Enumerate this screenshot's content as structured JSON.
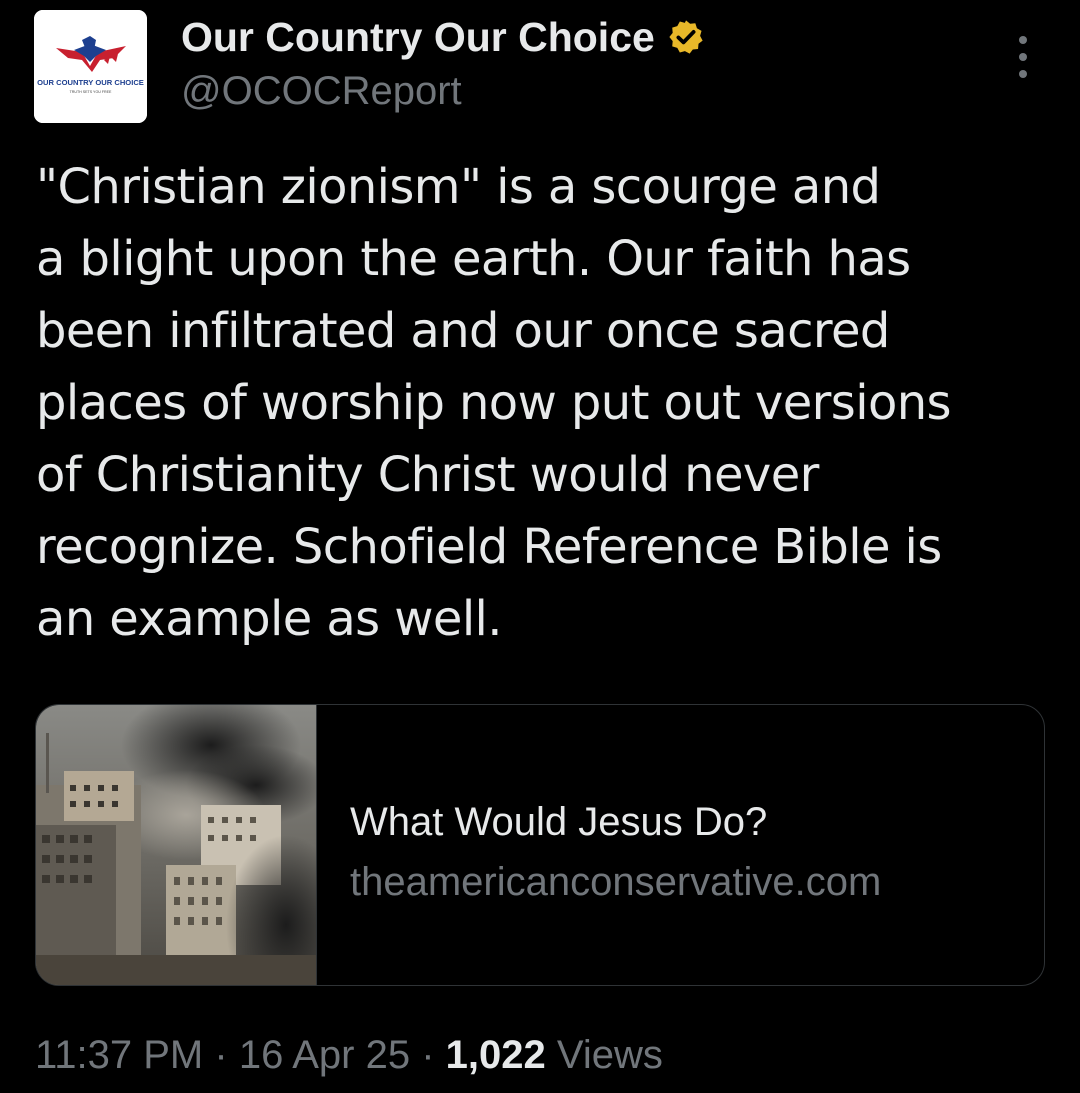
{
  "author": {
    "display_name": "Our Country Our Choice",
    "handle": "@OCOCReport",
    "verified": true,
    "verified_badge_color": "#e8b829",
    "avatar": {
      "logo_text": "OUR COUNTRY OUR CHOICE",
      "logo_subtext": "TRUTH SETS YOU FREE"
    }
  },
  "more_icon": "more-options-icon",
  "tweet": {
    "text": "\"Christian zionism\" is a scourge and\na blight upon the earth. Our faith has\nbeen infiltrated and our once sacred\nplaces of worship now put out versions\nof Christianity Christ would never\nrecognize. Schofield Reference Bible is\nan example as well."
  },
  "link_card": {
    "title": "What Would Jesus Do?",
    "domain": "theamericanconservative.com"
  },
  "meta": {
    "time": "11:37 PM",
    "separator": "·",
    "date": "16 Apr 25",
    "views_count": "1,022",
    "views_label": "Views"
  },
  "colors": {
    "background": "#000000",
    "text_primary": "#e7e9ea",
    "text_secondary": "#71767b",
    "border": "#2f3336"
  }
}
